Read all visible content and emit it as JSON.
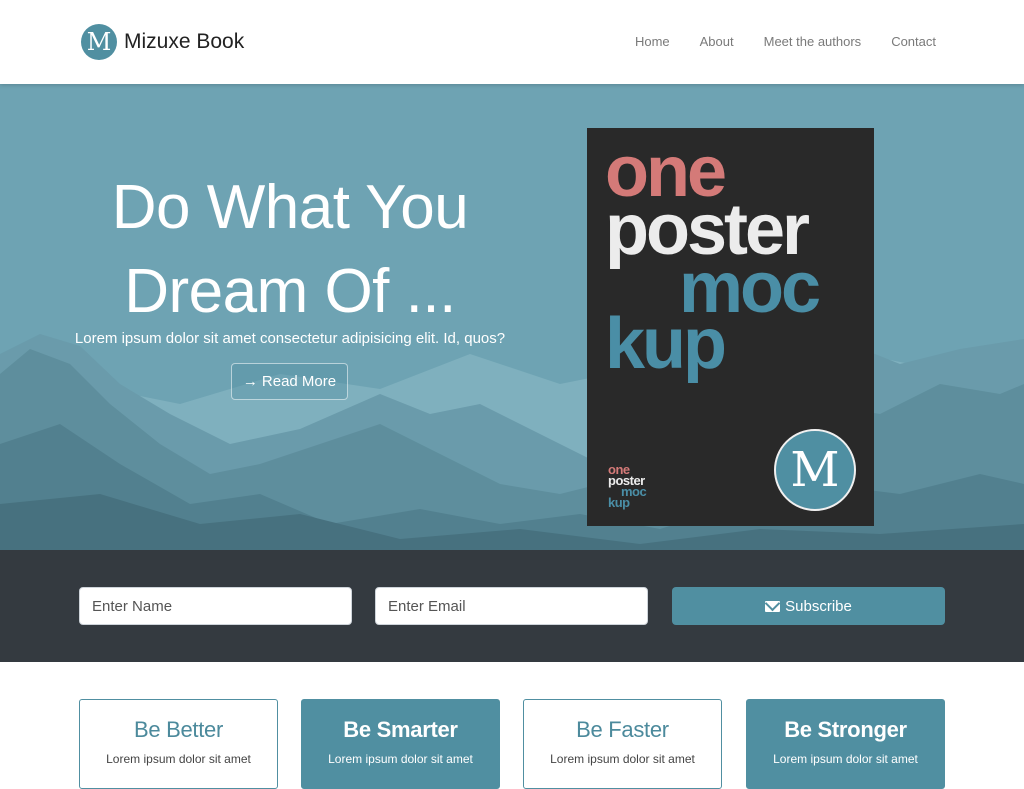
{
  "brand": {
    "logo_letter": "M",
    "name": "Mizuxe Book"
  },
  "nav": {
    "items": [
      "Home",
      "About",
      "Meet the authors",
      "Contact"
    ]
  },
  "hero": {
    "title_line1": "Do What You",
    "title_line2": "Dream Of ...",
    "subtitle": "Lorem ipsum dolor sit amet consectetur adipisicing elit. Id, quos?",
    "button_label": "Read More",
    "poster": {
      "words": [
        "one",
        "poster",
        "moc",
        "kup"
      ],
      "logo_letter": "M"
    }
  },
  "subscribe": {
    "name_placeholder": "Enter Name",
    "email_placeholder": "Enter Email",
    "button_label": "Subscribe"
  },
  "features": [
    {
      "title": "Be Better",
      "text": "Lorem ipsum dolor sit amet"
    },
    {
      "title": "Be Smarter",
      "text": "Lorem ipsum dolor sit amet"
    },
    {
      "title": "Be Faster",
      "text": "Lorem ipsum dolor sit amet"
    },
    {
      "title": "Be Stronger",
      "text": "Lorem ipsum dolor sit amet"
    }
  ],
  "colors": {
    "primary": "#508fa1",
    "dark": "#343a40",
    "hero_bg": "#6ea3b3",
    "poster_bg": "#292929"
  }
}
